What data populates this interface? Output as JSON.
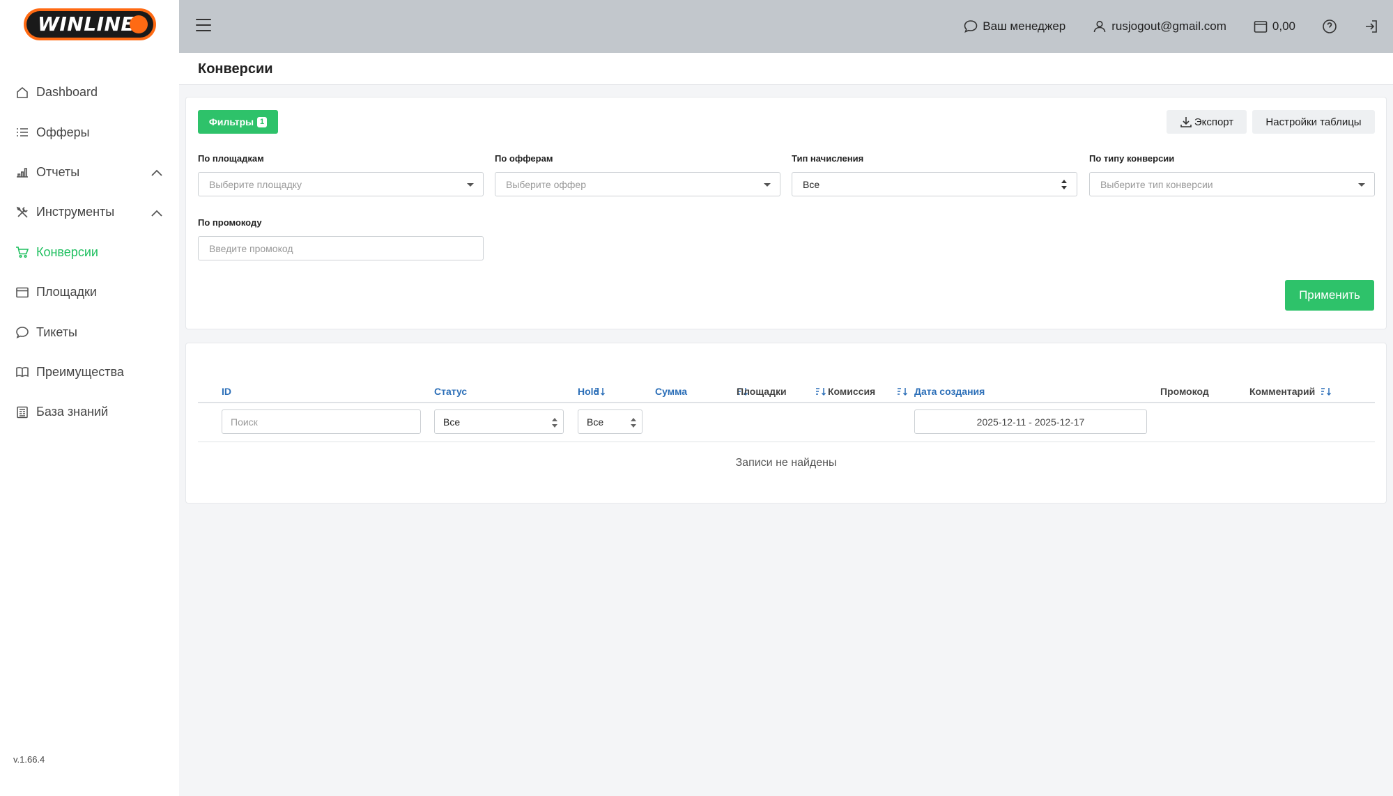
{
  "brand": {
    "logo_text": "WINLINE"
  },
  "sidebar": {
    "items": [
      {
        "label": "Dashboard",
        "icon": "home-icon"
      },
      {
        "label": "Офферы",
        "icon": "list-icon"
      },
      {
        "label": "Отчеты",
        "icon": "bar-chart-icon",
        "expandable": true
      },
      {
        "label": "Инструменты",
        "icon": "tools-icon",
        "expandable": true
      },
      {
        "label": "Конверсии",
        "icon": "cart-icon",
        "active": true
      },
      {
        "label": "Площадки",
        "icon": "browser-icon"
      },
      {
        "label": "Тикеты",
        "icon": "chat-icon"
      },
      {
        "label": "Преимущества",
        "icon": "book-icon"
      },
      {
        "label": "База знаний",
        "icon": "newspaper-icon"
      }
    ],
    "version": "v.1.66.4"
  },
  "header": {
    "manager_label": "Ваш менеджер",
    "user_email": "rusjogout@gmail.com",
    "balance": "0,00"
  },
  "page": {
    "title": "Конверсии"
  },
  "filters": {
    "filters_button": "Фильтры",
    "filters_count": "1",
    "export_button": "Экспорт",
    "table_settings_button": "Настройки таблицы",
    "platform": {
      "label": "По площадкам",
      "placeholder": "Выберите площадку"
    },
    "offer": {
      "label": "По офферам",
      "placeholder": "Выберите оффер"
    },
    "accrual_type": {
      "label": "Тип начисления",
      "value": "Все"
    },
    "conversion_type": {
      "label": "По типу конверсии",
      "placeholder": "Выберите тип конверсии"
    },
    "promo": {
      "label": "По промокоду",
      "placeholder": "Введите промокод"
    },
    "apply_button": "Применить"
  },
  "table": {
    "columns": [
      "ID",
      "Статус",
      "Hold",
      "Сумма",
      "Площадки",
      "Комиссия",
      "Дата создания",
      "Промокод",
      "Комментарий"
    ],
    "id_search_placeholder": "Поиск",
    "status_filter": "Все",
    "hold_filter": "Все",
    "date_range": "2025-12-11 - 2025-12-17",
    "empty_message": "Записи не найдены"
  },
  "colors": {
    "accent": "#2ec26a",
    "link": "#2c6fb8",
    "header_bg": "#c2c7cc",
    "logo_orange": "#ff6a13"
  }
}
